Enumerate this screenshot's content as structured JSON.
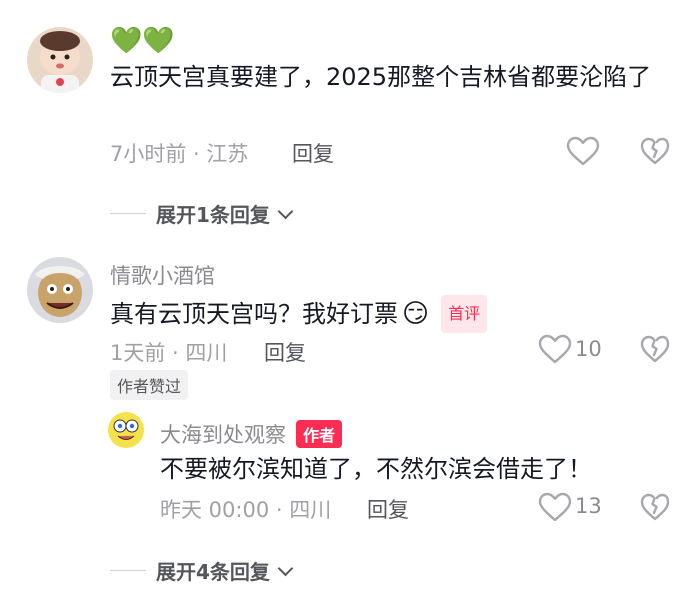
{
  "comment1": {
    "emojis": "💚💚",
    "text": "云顶天宫真要建了，2025那整个吉林省都要沦陷了",
    "meta": "7小时前 · 江苏",
    "reply_label": "回复",
    "expand_label": "展开1条回复"
  },
  "comment2": {
    "username": "情歌小酒馆",
    "text": "真有云顶天宫吗？我好订票",
    "emoji": "😏",
    "tag": "首评",
    "meta": "1天前 · 四川",
    "reply_label": "回复",
    "like_count": "10",
    "author_liked": "作者赞过"
  },
  "reply1": {
    "username": "大海到处观察",
    "tag": "作者",
    "text": "不要被尔滨知道了，不然尔滨会借走了！",
    "meta": "昨天 00:00 · 四川",
    "reply_label": "回复",
    "like_count": "13"
  },
  "expand2": {
    "label": "展开4条回复"
  },
  "colors": {
    "accent": "#fe2c55",
    "meta": "#a0a0a6",
    "icon": "#a7a7ad"
  },
  "icons": [
    "heart-icon",
    "dislike-heart-icon",
    "chevron-down-icon"
  ]
}
